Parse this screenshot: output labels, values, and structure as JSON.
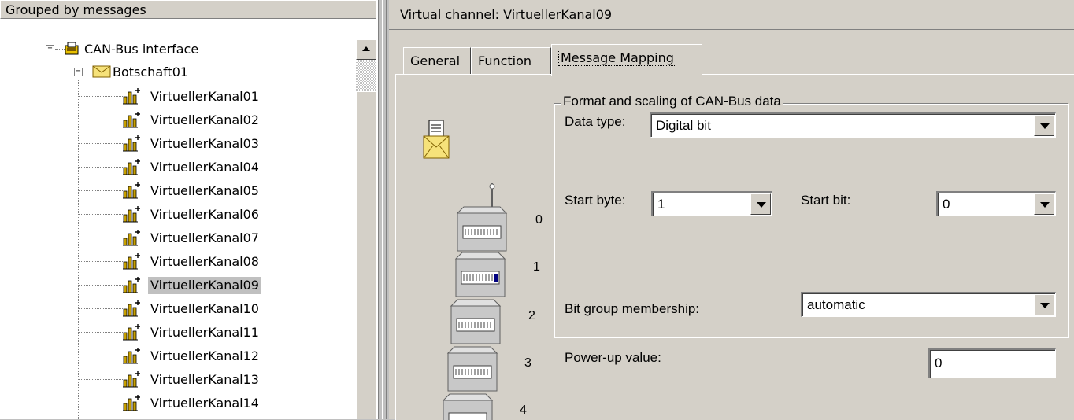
{
  "tree": {
    "header": "Grouped by messages",
    "root_label": "CAN-Bus interface",
    "message_label": "Botschaft01",
    "channels": [
      "VirtuellerKanal01",
      "VirtuellerKanal02",
      "VirtuellerKanal03",
      "VirtuellerKanal04",
      "VirtuellerKanal05",
      "VirtuellerKanal06",
      "VirtuellerKanal07",
      "VirtuellerKanal08",
      "VirtuellerKanal09",
      "VirtuellerKanal10",
      "VirtuellerKanal11",
      "VirtuellerKanal12",
      "VirtuellerKanal13",
      "VirtuellerKanal14"
    ],
    "selected": "VirtuellerKanal09",
    "expander_symbol": "−"
  },
  "panel": {
    "title": "Virtual channel: VirtuellerKanal09",
    "tabs": [
      {
        "label": "General"
      },
      {
        "label": "Function"
      },
      {
        "label": "Message Mapping"
      }
    ],
    "active_tab": "Message Mapping"
  },
  "mapping": {
    "group_title": "Format and scaling of CAN-Bus data",
    "data_type_label": "Data type:",
    "data_type_value": "Digital bit",
    "start_byte_label": "Start byte:",
    "start_byte_value": "1",
    "start_bit_label": "Start bit:",
    "start_bit_value": "0",
    "bit_group_label": "Bit group membership:",
    "bit_group_value": "automatic",
    "power_up_label": "Power-up value:",
    "power_up_value": "0",
    "module_numbers": [
      "0",
      "1",
      "2",
      "3",
      "4"
    ]
  },
  "icons": {
    "interface": "can-interface-icon",
    "message": "envelope-icon",
    "channel": "virtual-channel-icon",
    "mapping_message": "message-letter-icon",
    "module_stack": "module-stack-icon"
  },
  "colors": {
    "window_bg": "#d4d0c8",
    "tree_bg": "#ffffff",
    "selection_bg": "#c0c0c0",
    "highlight_led": "#000080"
  }
}
